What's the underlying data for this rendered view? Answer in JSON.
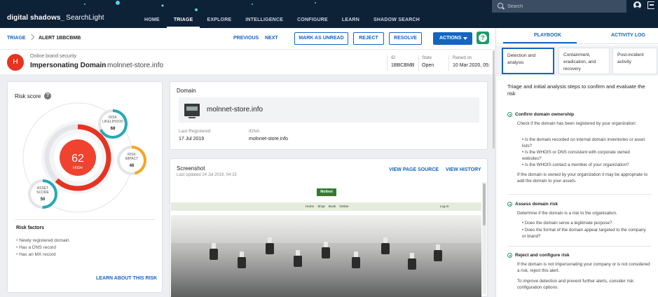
{
  "app": {
    "brand": "digital shadows_",
    "product": "SearchLight"
  },
  "nav": [
    "HOME",
    "TRIAGE",
    "EXPLORE",
    "INTELLIGENCE",
    "CONFIGURE",
    "LEARN",
    "SHADOW SEARCH"
  ],
  "nav_active": "TRIAGE",
  "search": {
    "placeholder": "Search"
  },
  "breadcrumb": {
    "root": "TRIAGE",
    "current": "ALERT 1BBCBMB"
  },
  "toolbar": {
    "previous": "PREVIOUS",
    "next": "NEXT",
    "mark_unread": "MARK AS UNREAD",
    "reject": "REJECT",
    "resolve": "RESOLVE",
    "actions": "ACTIONS"
  },
  "alert": {
    "avatar": "H",
    "category": "Online brand security",
    "title": "Impersonating Domain",
    "domain": "molnnet-store.info",
    "id_label": "ID",
    "id": "1BBCBMB",
    "state_label": "State",
    "state": "Open",
    "raised_label": "Raised on",
    "raised": "10 Mar 2020, 05:"
  },
  "risk": {
    "title": "Risk score",
    "score": "62",
    "score_label": "HIGH",
    "likelihood_label": "RISK LIKELIHOOD",
    "likelihood": "68",
    "impact_label": "RISK IMPACT",
    "impact": "46",
    "asset_label": "ASSET SCORE",
    "asset": "50",
    "factors_title": "Risk factors",
    "factors": [
      "Newly registered domain",
      "Has a DNS record",
      "Has an MX record"
    ],
    "learn": "LEARN ABOUT THIS RISK"
  },
  "domain_card": {
    "title": "Domain",
    "name": "molnnet-store.info",
    "registered_label": "Last Registered",
    "registered": "17 Jul 2019",
    "idna_label": "IDNA",
    "idna": "molnnet-store.info"
  },
  "screenshot_card": {
    "title": "Screenshot",
    "updated": "Last updated 24 Jul 2019, 04:15",
    "view_source": "VIEW PAGE SOURCE",
    "view_history": "VIEW HISTORY",
    "site_logo": "Mollnet",
    "site_links": "Home Shop Book Online",
    "site_login": "Log In"
  },
  "playbook": {
    "tabs": [
      "PLAYBOOK",
      "ACTIVITY LOG"
    ],
    "stages": [
      "Detection and analysis",
      "Containment, eradication, and recovery",
      "Post-incident activity"
    ],
    "intro": "Triage and initial analysis steps to confirm and evaluate the risk",
    "steps": [
      {
        "title": "Confirm domain ownership",
        "text": "Check if the domain has been registered by your organization:",
        "bullets": [
          "Is the domain recorded on internal domain inventories or asset lists?",
          "Is the WHOIS or DNS consistent with corporate owned websites?",
          "Is the WHOIS contact a member of your organization?"
        ],
        "after": "If the domain is owned by your organization it may be appropriate to add the domain to your assets."
      },
      {
        "title": "Assess domain risk",
        "text": "Determine if the domain is a risk to the organisation.",
        "bullets": [
          "Does the domain serve a legitimate purpose?",
          "Does the format of the domain appear targeted to the company or brand?"
        ]
      },
      {
        "title": "Reject and configure risk",
        "text": "If the domain is not Impersonating your company or is not considered a risk, reject this alert.",
        "after": "To improve detection and prevent further alerts, consider risk configuration options:"
      }
    ]
  },
  "colors": {
    "primary": "#1565c0",
    "high": "#e53421",
    "topbar": "#0d2137",
    "teal": "#26a9b8",
    "amber": "#f5a623"
  }
}
